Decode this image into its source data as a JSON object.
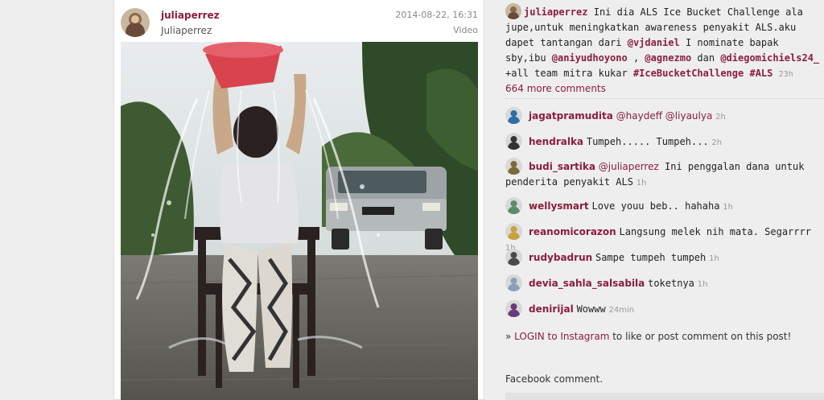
{
  "post": {
    "username": "juliaperrez",
    "fullname": "Juliaperrez",
    "date": "2014-08-22, 16:31",
    "media_type": "Video"
  },
  "caption": {
    "username": "juliaperrez",
    "text1": "Ini dia ALS Ice Bucket Challenge ala jupe,untuk meningkatkan awareness penyakit ALS.aku dapet tantangan dari ",
    "m1": "@vjdaniel",
    "text2": " I nominate bapak sby,ibu ",
    "m2": "@aniyudhoyono",
    "text3": " , ",
    "m3": "@agnezmo",
    "text4": " dan ",
    "m4": "@diegomichiels24_",
    "text5": " +all team mitra kukar ",
    "h1": "#IceBucketChallenge",
    "text6": " ",
    "h2": "#ALS",
    "time": "23h"
  },
  "more_comments": "664 more comments",
  "comments": [
    {
      "user": "jagatpramudita",
      "mentions": "@haydeff @liyaulya",
      "text": "",
      "time": "2h",
      "avatar_color": "#2b6fa3"
    },
    {
      "user": "hendralka",
      "mentions": "",
      "text": "Tumpeh..... Tumpeh...",
      "time": "2h",
      "avatar_color": "#333333"
    },
    {
      "user": "budi_sartika",
      "mentions": "@juliaperrez",
      "text": " Ini penggalan dana untuk penderita penyakit ALS",
      "time": "1h",
      "avatar_color": "#7a6a3a"
    },
    {
      "user": "wellysmart",
      "mentions": "",
      "text": "Love youu beb.. hahaha",
      "time": "1h",
      "avatar_color": "#5a8a6a"
    },
    {
      "user": "reanomicorazon",
      "mentions": "",
      "text": "Langsung melek nih mata. Segarrrr",
      "time": "1h",
      "avatar_color": "#c9a23a"
    },
    {
      "user": "rudybadrun",
      "mentions": "",
      "text": "Sampe tumpeh tumpeh",
      "time": "1h",
      "avatar_color": "#4a4a4a"
    },
    {
      "user": "devia_sahla_salsabila",
      "mentions": "",
      "text": "toketnya",
      "time": "1h",
      "avatar_color": "#8aa0b8"
    },
    {
      "user": "denirijal",
      "mentions": "",
      "text": "Wowww",
      "time": "24min",
      "avatar_color": "#6a3a7a"
    }
  ],
  "login": {
    "prefix": "» ",
    "link": "LOGIN to Instagram",
    "suffix": " to like or post comment on this post!"
  },
  "facebook_label": "Facebook comment.",
  "colors": {
    "accent": "#8a1e3c",
    "background": "#eeeeee"
  }
}
